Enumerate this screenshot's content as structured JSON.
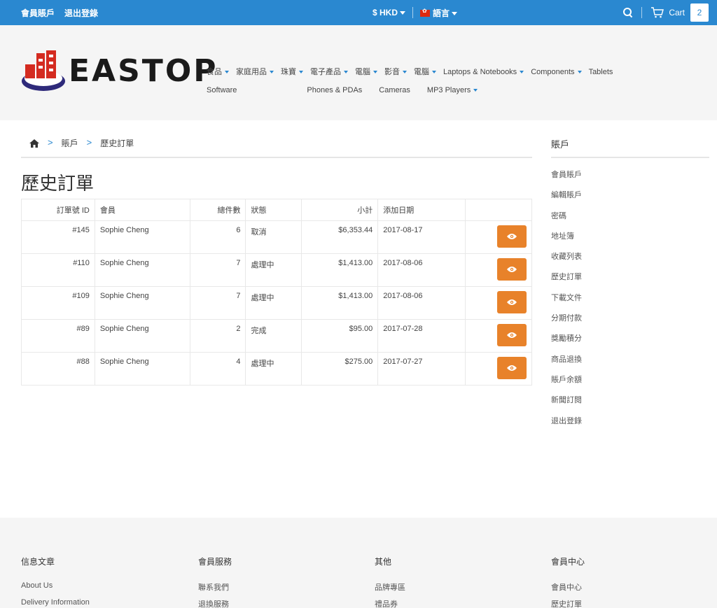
{
  "topbar": {
    "account": "會員賬戶",
    "logout": "退出登錄",
    "currency": "$ HKD",
    "language": "語言",
    "cart_label": "Cart",
    "cart_count": "2"
  },
  "logo": {
    "text": "EASTOP"
  },
  "nav": {
    "items": [
      {
        "label": "食品",
        "dropdown": true
      },
      {
        "label": "家庭用品",
        "dropdown": true
      },
      {
        "label": "珠寶",
        "dropdown": true
      },
      {
        "label": "電子產品",
        "dropdown": true
      },
      {
        "label": "電腦",
        "dropdown": true
      },
      {
        "label": "影音",
        "dropdown": true
      },
      {
        "label": "電腦",
        "dropdown": true
      },
      {
        "label": "Laptops & Notebooks",
        "dropdown": true
      },
      {
        "label": "Components",
        "dropdown": true
      },
      {
        "label": "Tablets",
        "dropdown": false
      },
      {
        "label": "Software",
        "dropdown": false
      },
      {
        "label": "Phones & PDAs",
        "dropdown": false
      },
      {
        "label": "Cameras",
        "dropdown": false
      },
      {
        "label": "MP3 Players",
        "dropdown": true
      }
    ]
  },
  "breadcrumb": {
    "account": "賬戶",
    "current": "歷史訂單"
  },
  "page": {
    "title": "歷史訂單"
  },
  "orders": {
    "headers": {
      "id": "訂單號 ID",
      "customer": "會員",
      "qty": "總件數",
      "status": "狀態",
      "total": "小計",
      "date": "添加日期"
    },
    "rows": [
      {
        "id": "#145",
        "customer": "Sophie Cheng",
        "qty": "6",
        "status": "取消",
        "total": "$6,353.44",
        "date": "2017-08-17"
      },
      {
        "id": "#110",
        "customer": "Sophie Cheng",
        "qty": "7",
        "status": "處理中",
        "total": "$1,413.00",
        "date": "2017-08-06"
      },
      {
        "id": "#109",
        "customer": "Sophie Cheng",
        "qty": "7",
        "status": "處理中",
        "total": "$1,413.00",
        "date": "2017-08-06"
      },
      {
        "id": "#89",
        "customer": "Sophie Cheng",
        "qty": "2",
        "status": "完成",
        "total": "$95.00",
        "date": "2017-07-28"
      },
      {
        "id": "#88",
        "customer": "Sophie Cheng",
        "qty": "4",
        "status": "處理中",
        "total": "$275.00",
        "date": "2017-07-27"
      }
    ],
    "button_color": "#e8822a"
  },
  "sidebar": {
    "title": "賬戶",
    "items": [
      "會員賬戶",
      "編輯賬戶",
      "密碼",
      "地址簿",
      "收藏列表",
      "歷史訂單",
      "下載文件",
      "分期付款",
      "獎勵積分",
      "商品退換",
      "賬戶余額",
      "新聞訂閱",
      "退出登錄"
    ]
  },
  "footer": {
    "columns": [
      {
        "title": "信息文章",
        "items": [
          "About Us",
          "Delivery Information"
        ]
      },
      {
        "title": "會員服務",
        "items": [
          "聯系我們",
          "退換服務"
        ]
      },
      {
        "title": "其他",
        "items": [
          "品牌專區",
          "禮品券"
        ]
      },
      {
        "title": "會員中心",
        "items": [
          "會員中心",
          "歷史訂單"
        ]
      }
    ]
  },
  "colors": {
    "topbar": "#2a88d0",
    "accent": "#2a88d0",
    "button": "#e8822a"
  }
}
